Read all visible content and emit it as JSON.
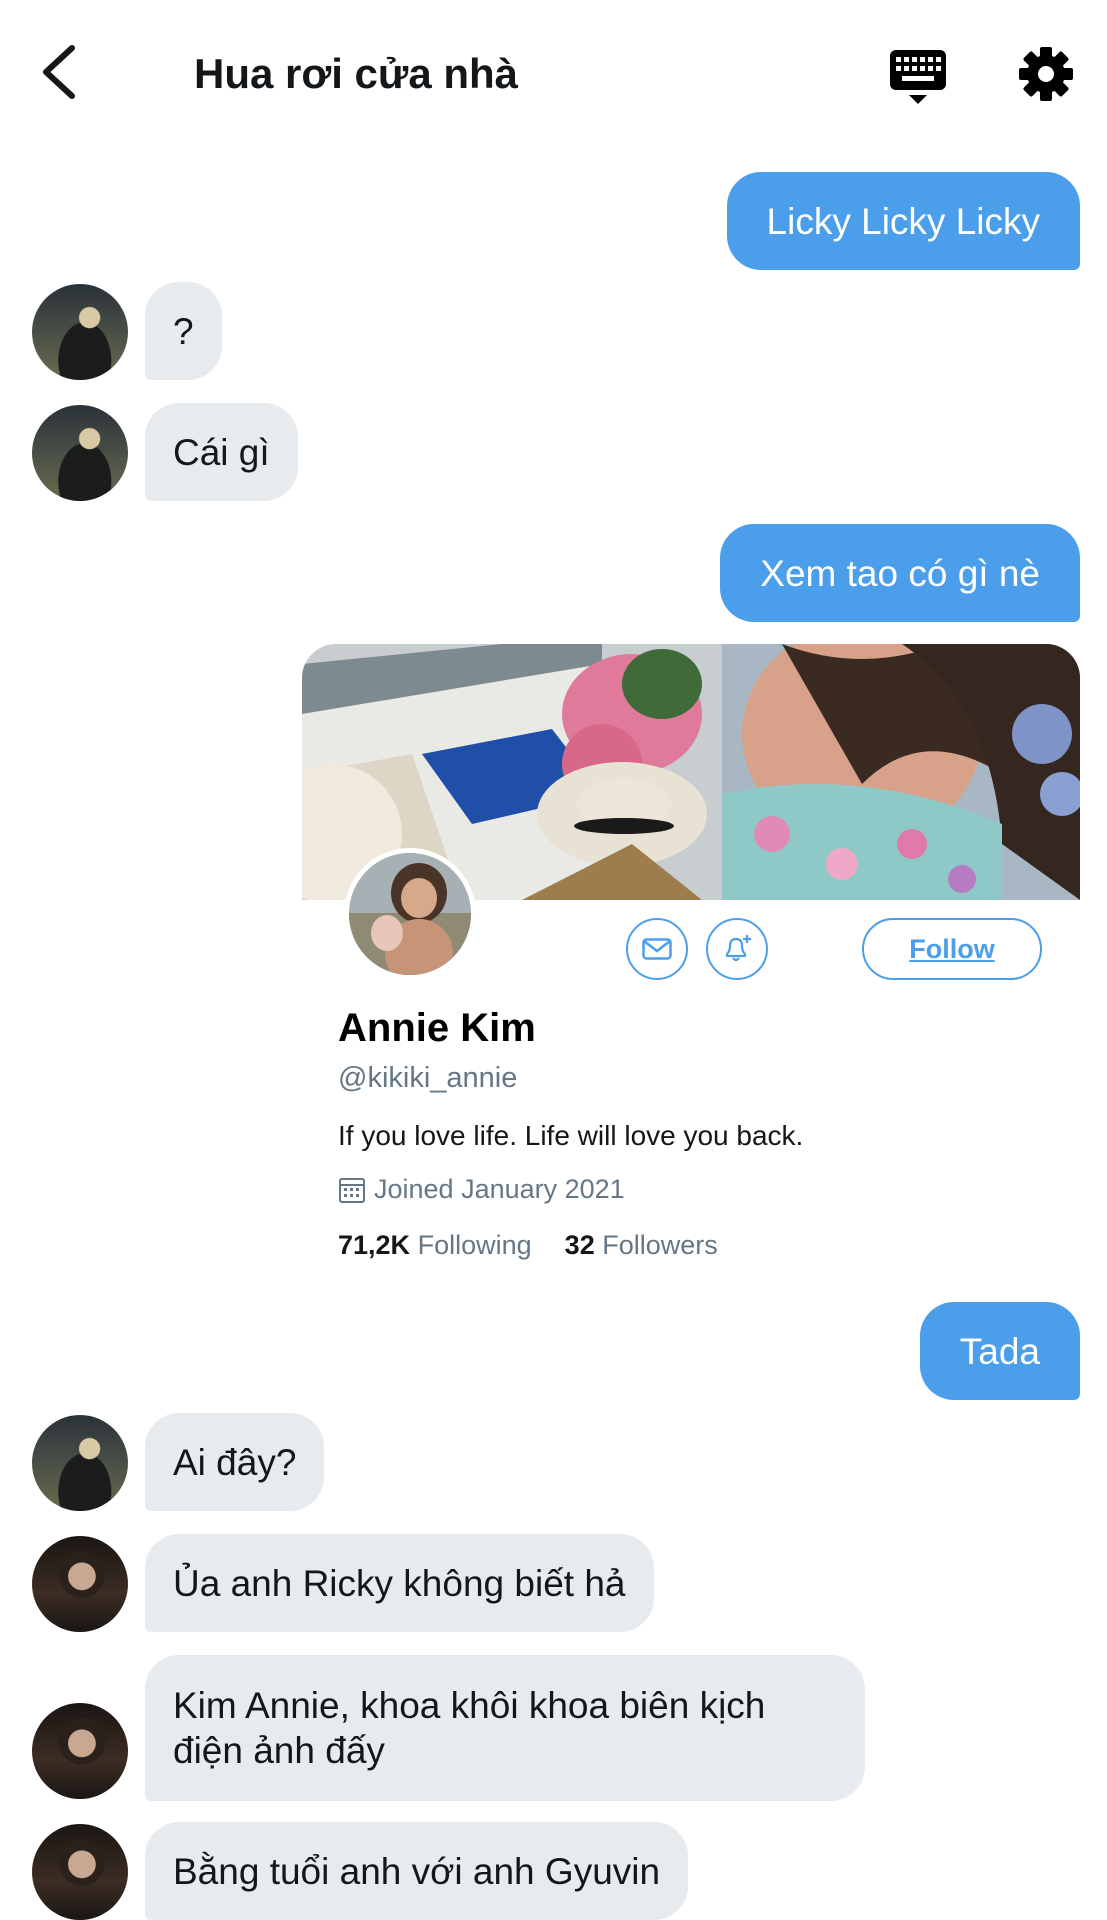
{
  "header": {
    "title": "Hua rơi cửa nhà"
  },
  "messages": {
    "m1": "Licky Licky Licky",
    "m2": "?",
    "m3": "Cái gì",
    "m4": "Xem tao có gì nè",
    "m5": "Tada",
    "m6": "Ai đây?",
    "m7": "Ủa anh Ricky không biết hả",
    "m8": "Kim Annie, khoa khôi khoa biên kịch điện ảnh đấy",
    "m9": "Bằng tuổi anh với anh Gyuvin"
  },
  "profile_card": {
    "name": "Annie Kim",
    "handle": "@kikiki_annie",
    "bio": "If you love life. Life will love you back.",
    "joined": "Joined January 2021",
    "following_count": "71,2K",
    "following_label": "Following",
    "followers_count": "32",
    "followers_label": "Followers",
    "follow_label": "Follow"
  },
  "colors": {
    "accent": "#4a9eea",
    "incoming_bubble": "#e8ebee",
    "muted_text": "#657786"
  },
  "icons": [
    "back-arrow-icon",
    "keyboard-icon",
    "gear-icon",
    "envelope-icon",
    "bell-plus-icon",
    "calendar-icon"
  ]
}
